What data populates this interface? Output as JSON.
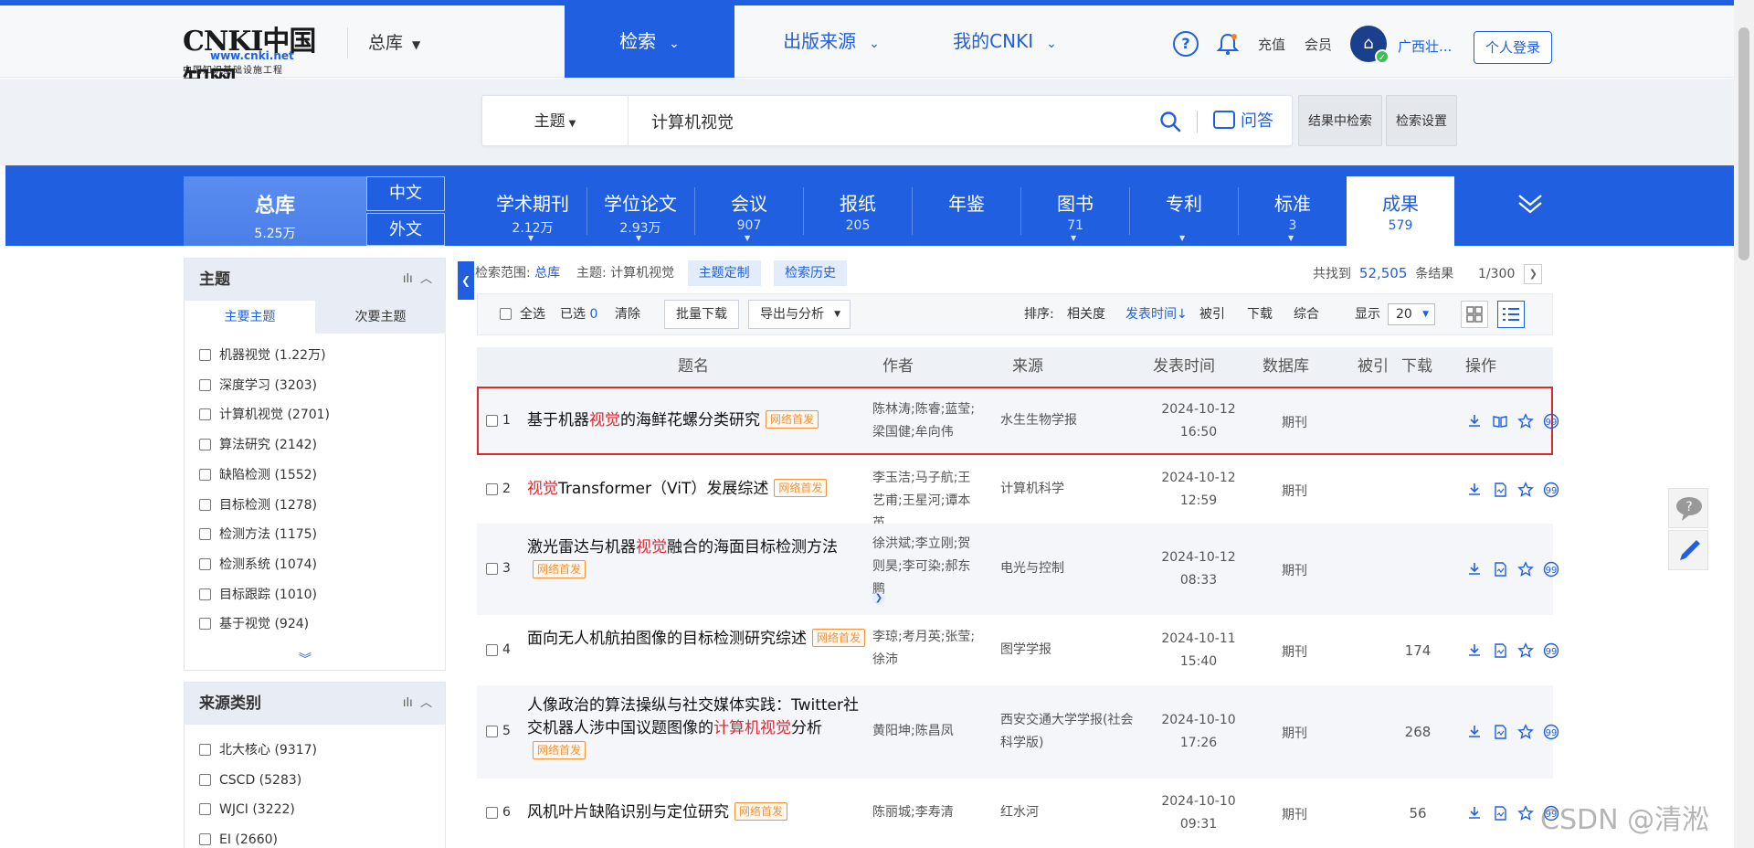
{
  "brand": {
    "logo_main": "CNKI中国知网",
    "logo_url": "www.cnki.net",
    "logo_sub": "中国知识基础设施工程"
  },
  "header": {
    "library": "总库",
    "nav": [
      {
        "label": "检索",
        "active": true
      },
      {
        "label": "出版来源",
        "active": false
      },
      {
        "label": "我的CNKI",
        "active": false
      }
    ],
    "recharge": "充值",
    "member": "会员",
    "org_name": "广西壮...",
    "login": "个人登录"
  },
  "search": {
    "field": "主题",
    "query": "计算机视觉",
    "qa": "问答",
    "within_results": "结果中检索",
    "settings": "检索设置"
  },
  "total": {
    "label": "总库",
    "count": "5.25万",
    "lang_cn": "中文",
    "lang_foreign": "外文"
  },
  "categories": [
    {
      "name": "学术期刊",
      "count": "2.12万",
      "dropdown": true
    },
    {
      "name": "学位论文",
      "count": "2.93万",
      "dropdown": true
    },
    {
      "name": "会议",
      "count": "907",
      "dropdown": true
    },
    {
      "name": "报纸",
      "count": "205",
      "dropdown": false
    },
    {
      "name": "年鉴",
      "count": "",
      "dropdown": false
    },
    {
      "name": "图书",
      "count": "71",
      "dropdown": true
    },
    {
      "name": "专利",
      "count": "",
      "dropdown": true
    },
    {
      "name": "标准",
      "count": "3",
      "dropdown": true
    },
    {
      "name": "成果",
      "count": "579",
      "dropdown": false,
      "active": true
    }
  ],
  "topic_filter": {
    "title": "主题",
    "tab_main": "主要主题",
    "tab_sub": "次要主题",
    "items": [
      "机器视觉 (1.22万)",
      "深度学习 (3203)",
      "计算机视觉 (2701)",
      "算法研究 (2142)",
      "缺陷检测 (1552)",
      "目标检测 (1278)",
      "检测方法 (1175)",
      "检测系统 (1074)",
      "目标跟踪 (1010)",
      "基于视觉 (924)"
    ]
  },
  "source_filter": {
    "title": "来源类别",
    "items": [
      "北大核心 (9317)",
      "CSCD (5283)",
      "WJCI (3222)",
      "EI (2660)"
    ]
  },
  "scope": {
    "label": "检索范围:",
    "scope_value": "总库",
    "topic_label": "主题:",
    "topic_value": "计算机视觉",
    "custom": "主题定制",
    "history": "检索历史",
    "found_prefix": "共找到",
    "found_count": "52,505",
    "found_suffix": "条结果",
    "page": "1/300"
  },
  "toolbar": {
    "select_all": "全选",
    "selected_label": "已选",
    "selected_count": "0",
    "clear": "清除",
    "batch_download": "批量下载",
    "export": "导出与分析",
    "sort_label": "排序:",
    "sort_relevance": "相关度",
    "sort_date": "发表时间",
    "sort_cited": "被引",
    "sort_download": "下载",
    "sort_overall": "综合",
    "display_label": "显示",
    "display_value": "20"
  },
  "table_headers": {
    "title": "题名",
    "author": "作者",
    "source": "来源",
    "date": "发表时间",
    "db": "数据库",
    "cited": "被引",
    "download": "下载",
    "ops": "操作"
  },
  "results": [
    {
      "no": "1",
      "title_pre": "基于机器",
      "hl": "视觉",
      "title_post": "的海鲜花螺分类研究",
      "tag": "网络首发",
      "authors": "陈林涛;陈睿;蓝莹;梁国健;牟向伟",
      "source": "水生生物学报",
      "date": "2024-10-12",
      "time": "16:50",
      "db": "期刊",
      "cited": "",
      "downloads": ""
    },
    {
      "no": "2",
      "title_pre": "",
      "hl": "视觉",
      "title_post": "Transformer（ViT）发展综述",
      "tag": "网络首发",
      "authors": "李玉洁;马子航;王艺甫;王星河;谭本英",
      "source": "计算机科学",
      "date": "2024-10-12",
      "time": "12:59",
      "db": "期刊",
      "cited": "",
      "downloads": ""
    },
    {
      "no": "3",
      "title_pre": "激光雷达与机器",
      "hl": "视觉",
      "title_post": "融合的海面目标检测方法",
      "tag": "网络首发",
      "authors": "徐洪斌;李立刚;贺则昊;李可染;郝东鹏",
      "source": "电光与控制",
      "date": "2024-10-12",
      "time": "08:33",
      "db": "期刊",
      "cited": "",
      "downloads": ""
    },
    {
      "no": "4",
      "title_pre": "面向无人机航拍图像的目标检测研究综述",
      "hl": "",
      "title_post": "",
      "tag": "网络首发",
      "authors": "李琼;考月英;张莹;徐沛",
      "source": "图学学报",
      "date": "2024-10-11",
      "time": "15:40",
      "db": "期刊",
      "cited": "",
      "downloads": "174"
    },
    {
      "no": "5",
      "title_pre": "人像政治的算法操纵与社交媒体实践：Twitter社交机器人涉中国议题图像的",
      "hl": "计算机视觉",
      "title_post": "分析",
      "tag": "网络首发",
      "authors": "黄阳坤;陈昌凤",
      "source": "西安交通大学学报(社会科学版)",
      "date": "2024-10-10",
      "time": "17:26",
      "db": "期刊",
      "cited": "",
      "downloads": "268"
    },
    {
      "no": "6",
      "title_pre": "风机叶片缺陷识别与定位研究",
      "hl": "",
      "title_post": "",
      "tag": "网络首发",
      "authors": "陈丽城;李寿清",
      "source": "红水河",
      "date": "2024-10-10",
      "time": "09:31",
      "db": "期刊",
      "cited": "",
      "downloads": "56"
    }
  ],
  "watermark": "CSDN @清淞"
}
